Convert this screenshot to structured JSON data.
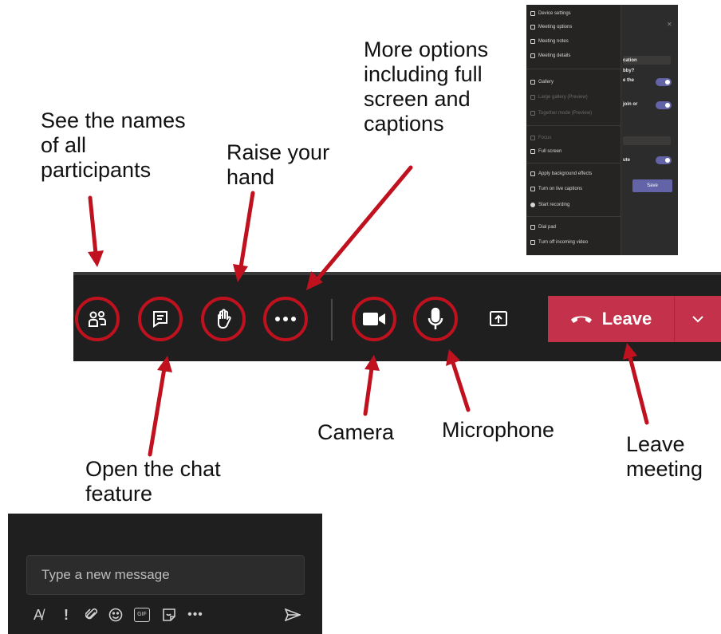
{
  "annotations": {
    "participants": [
      "See the names",
      "of all",
      "participants"
    ],
    "raise_hand": [
      "Raise your",
      "hand"
    ],
    "more_options": [
      "More options",
      "including full",
      "screen and",
      "captions"
    ],
    "chat": [
      "Open the chat",
      "feature"
    ],
    "camera": [
      "Camera"
    ],
    "microphone": [
      "Microphone"
    ],
    "leave": [
      "Leave",
      "meeting"
    ]
  },
  "toolbar": {
    "leave_label": "Leave"
  },
  "more_menu": {
    "items": [
      "Device settings",
      "Meeting options",
      "Meeting notes",
      "Meeting details",
      "Gallery",
      "Large gallery (Preview)",
      "Together mode (Preview)",
      "Focus",
      "Full screen",
      "Apply background effects",
      "Turn on live captions",
      "Start recording",
      "Dial pad",
      "Turn off incoming video"
    ],
    "side_labels": [
      "bby?",
      "cation",
      "e the",
      "join or",
      "ute"
    ],
    "save_label": "Save"
  },
  "compose": {
    "placeholder": "Type a new message",
    "gif_label": "GIF"
  },
  "colors": {
    "annotation_red": "#c0111f",
    "toolbar_bg": "#201f1f",
    "leave_red": "#c4314b",
    "accent_purple": "#6264a7"
  }
}
